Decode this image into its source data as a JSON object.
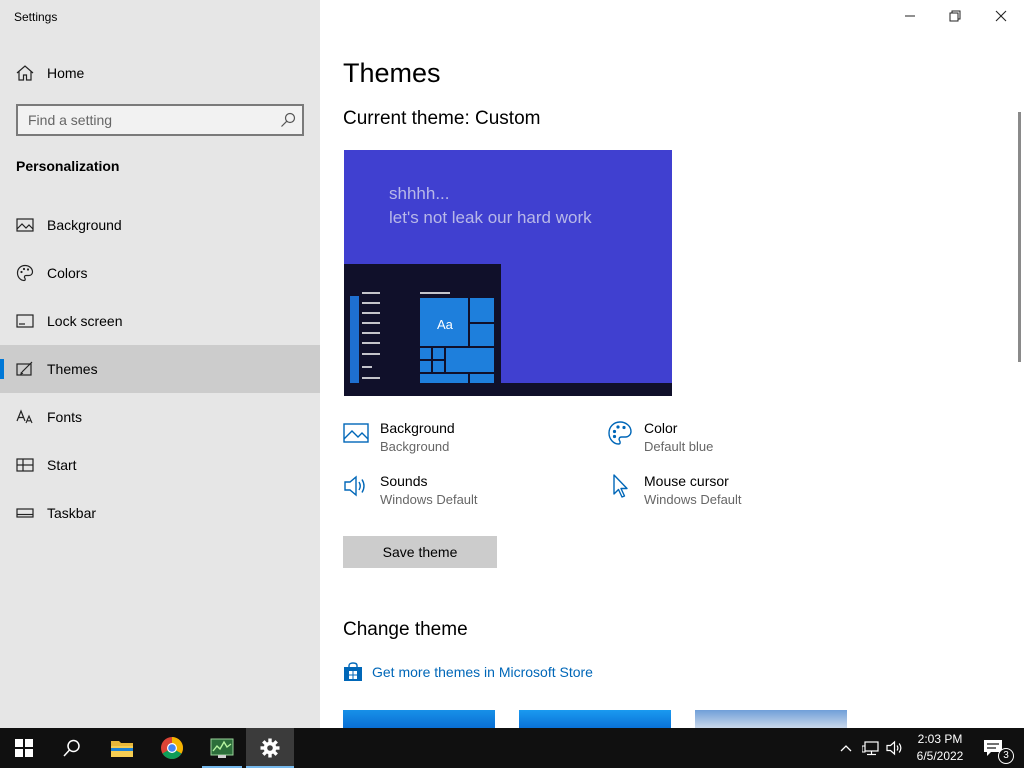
{
  "window": {
    "title": "Settings"
  },
  "sidebar": {
    "home_label": "Home",
    "search_placeholder": "Find a setting",
    "section_label": "Personalization",
    "items": [
      {
        "label": "Background",
        "icon": "picture-icon"
      },
      {
        "label": "Colors",
        "icon": "palette-icon"
      },
      {
        "label": "Lock screen",
        "icon": "lock-screen-icon"
      },
      {
        "label": "Themes",
        "icon": "themes-icon",
        "active": true
      },
      {
        "label": "Fonts",
        "icon": "fonts-icon"
      },
      {
        "label": "Start",
        "icon": "start-icon"
      },
      {
        "label": "Taskbar",
        "icon": "taskbar-icon"
      }
    ]
  },
  "main": {
    "page_title": "Themes",
    "current_theme_label": "Current theme: Custom",
    "preview": {
      "line1": "shhhh...",
      "line2": "let's not leak our hard work",
      "tile_label": "Aa"
    },
    "attributes": {
      "background": {
        "title": "Background",
        "value": "Background"
      },
      "color": {
        "title": "Color",
        "value": "Default blue"
      },
      "sounds": {
        "title": "Sounds",
        "value": "Windows Default"
      },
      "mouse_cursor": {
        "title": "Mouse cursor",
        "value": "Windows Default"
      }
    },
    "save_button": "Save theme",
    "change_theme_title": "Change theme",
    "store_link": "Get more themes in Microsoft Store"
  },
  "taskbar": {
    "time": "2:03 PM",
    "date": "6/5/2022",
    "notification_count": "3"
  },
  "colors": {
    "accent": "#0078d7",
    "sidebar_bg": "#e6e6e6",
    "link": "#0067b8",
    "taskbar_bg": "#101010",
    "preview_bg": "#4040d0"
  }
}
